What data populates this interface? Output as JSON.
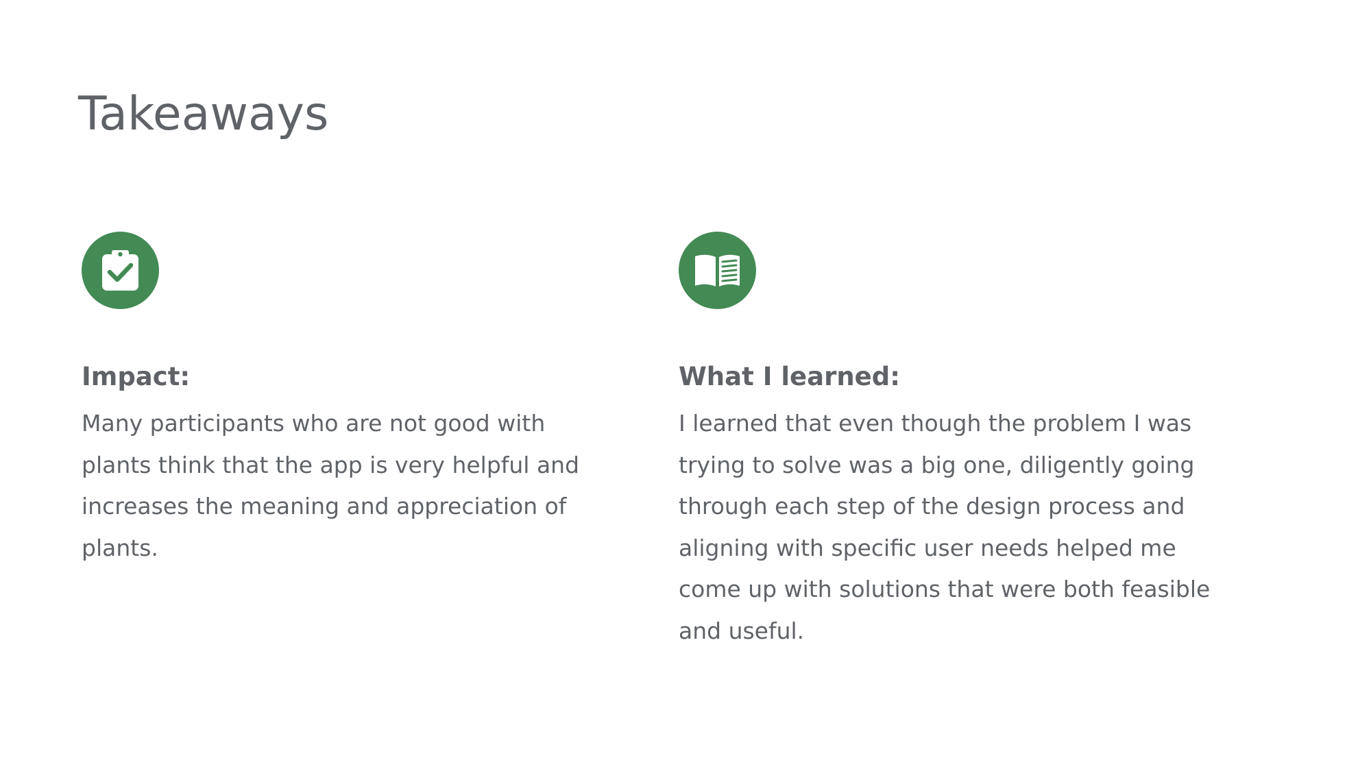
{
  "slide": {
    "title": "Takeaways"
  },
  "theme": {
    "accent": "#438a55",
    "text": "#5f6368",
    "background": "#ffffff"
  },
  "impact": {
    "icon": "clipboard-check-icon",
    "heading": "Impact:",
    "lines": [
      "Many participants who are not good with",
      "plants think that the app is very helpful and",
      "increases the meaning and appreciation of",
      "plants."
    ]
  },
  "learned": {
    "icon": "open-book-icon",
    "heading": "What I learned:",
    "lines": [
      "I learned that even though the problem I was",
      "trying to solve was a big one, diligently going",
      "through each step of the design process and",
      "aligning with specific user needs helped me",
      "come up with solutions that were both feasible",
      "and useful."
    ]
  }
}
